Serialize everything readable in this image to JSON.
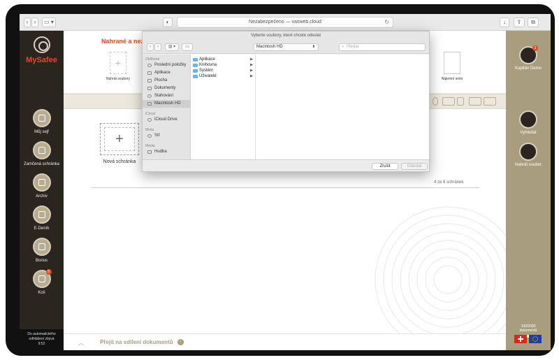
{
  "browser": {
    "url_text": "Nezabezpečeno — vasweb.cloud"
  },
  "app": {
    "logo_text": "MySafee"
  },
  "left_nav": [
    {
      "label": "Můj sejf",
      "icon": "safe-icon"
    },
    {
      "label": "Zamčená schránka",
      "icon": "lock-icon"
    },
    {
      "label": "Archiv",
      "icon": "archive-icon"
    },
    {
      "label": "E-Deník",
      "icon": "diary-icon"
    },
    {
      "label": "Bonus",
      "icon": "gift-icon"
    },
    {
      "label": "Koš",
      "icon": "trash-icon",
      "badge": "5"
    }
  ],
  "autologout": {
    "text": "Do automatického odhlášení zbývá",
    "time": "9:52"
  },
  "user": {
    "name": "Kapitán Demo",
    "badge": "5"
  },
  "right_nav": [
    {
      "label": "Vyhledat",
      "icon": "search-icon"
    },
    {
      "label": "Nahrát soubor",
      "icon": "upload-icon"
    }
  ],
  "storage": {
    "count_text": "100/2000",
    "unit": "dokumentů",
    "fraction": 0.05
  },
  "upload_strip": {
    "title": "Nahrané a neza",
    "tiles": [
      "Nahrát soubory",
      "Nájemní smlo"
    ]
  },
  "main": {
    "new_box_label": "Nová schránka",
    "count_text": "4 ze 6 schránek"
  },
  "bottom": {
    "share_text": "Přejít na sdílení dokumentů"
  },
  "dialog": {
    "prompt": "Vyberte soubory, které chcete odeslat",
    "location": "Macintosh HD",
    "search_placeholder": "Hledat",
    "sections": [
      {
        "title": "Oblíbené",
        "items": [
          {
            "label": "Poslední položky"
          },
          {
            "label": "Aplikace"
          },
          {
            "label": "Plocha"
          },
          {
            "label": "Dokumenty"
          },
          {
            "label": "Stahování"
          },
          {
            "label": "Macintosh HD",
            "selected": true
          }
        ]
      },
      {
        "title": "iCloud",
        "items": [
          {
            "label": "iCloud Drive"
          }
        ]
      },
      {
        "title": "Místa",
        "items": [
          {
            "label": "Síť"
          }
        ]
      },
      {
        "title": "Média",
        "items": [
          {
            "label": "Hudba"
          }
        ]
      }
    ],
    "files": [
      "Aplikace",
      "Knihovna",
      "Systém",
      "Uživatelé"
    ],
    "cancel_label": "Zrušit",
    "submit_label": "Odeslat"
  }
}
